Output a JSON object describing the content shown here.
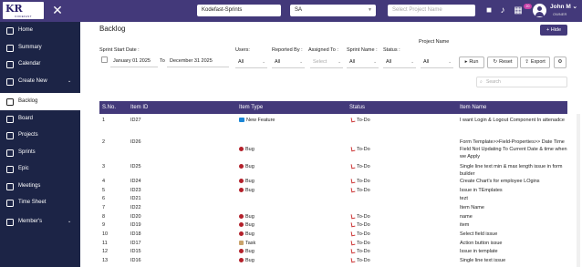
{
  "brand": {
    "logo_text": "KR",
    "logo_sub": "KODEFAST"
  },
  "topbar": {
    "workspace": "Kodefast-Sprints",
    "project_code": "SA",
    "project_placeholder": "Select Project Name",
    "notification_count": "20",
    "user_name": "John M",
    "user_role": "OWNER"
  },
  "sidebar": {
    "items": [
      {
        "label": "Home"
      },
      {
        "label": "Summary"
      },
      {
        "label": "Calendar"
      },
      {
        "label": "Create New"
      },
      {
        "label": "Backlog"
      },
      {
        "label": "Board"
      },
      {
        "label": "Projects"
      },
      {
        "label": "Sprints"
      },
      {
        "label": "Epic"
      },
      {
        "label": "Meetings"
      },
      {
        "label": "Time Sheet"
      },
      {
        "label": "Member's"
      }
    ]
  },
  "page": {
    "title": "Backlog",
    "hide_label": "Hide"
  },
  "filters": {
    "sprint_start_label": "Sprint Start Date :",
    "date_from": "January 01 2025",
    "to_label": "To",
    "date_to": "December 31 2025",
    "users_label": "Users:",
    "users_value": "All",
    "reported_by_label": "Reported By :",
    "reported_by_value": "All",
    "assigned_to_label": "Assigned To :",
    "assigned_to_value": "Select",
    "sprint_name_label": "Sprint Name :",
    "sprint_name_value": "All",
    "status_label": "Status :",
    "status_value": "All",
    "project_name_label": "Project Name",
    "project_name_value": "All",
    "run_label": "Run",
    "reset_label": "Reset",
    "export_label": "Export",
    "search_placeholder": "Search"
  },
  "table": {
    "headers": {
      "sno": "S.No.",
      "item_id": "Item ID",
      "item_type": "Item Type",
      "status": "Status",
      "item_name": "Item Name"
    },
    "rows": [
      {
        "sno": "1",
        "item_id": "ID27",
        "type": "New Feature",
        "type_icon": "new-feature",
        "status": "To-Do",
        "name": "I want Login & Logout Component In attenadce"
      },
      {
        "sno": "2",
        "item_id": "ID26",
        "type": "Bug",
        "type_icon": "bug",
        "status": "To-Do",
        "name": "Form Template>>Field-Properties>> Date Time Field Not Updating To Current Date & time when we Apply"
      },
      {
        "sno": "3",
        "item_id": "ID25",
        "type": "Bug",
        "type_icon": "bug",
        "status": "To-Do",
        "name": "Single line text min & max length issue in form builder"
      },
      {
        "sno": "4",
        "item_id": "ID24",
        "type": "Bug",
        "type_icon": "bug",
        "status": "To-Do",
        "name": "Create Chart's for employee LOgins"
      },
      {
        "sno": "5",
        "item_id": "ID23",
        "type": "Bug",
        "type_icon": "bug",
        "status": "To-Do",
        "name": "Issue in TEmplates"
      },
      {
        "sno": "6",
        "item_id": "ID21",
        "type": "",
        "type_icon": "",
        "status": "",
        "name": "tezt"
      },
      {
        "sno": "7",
        "item_id": "ID22",
        "type": "",
        "type_icon": "",
        "status": "",
        "name": "Item Name"
      },
      {
        "sno": "8",
        "item_id": "ID20",
        "type": "Bug",
        "type_icon": "bug",
        "status": "To-Do",
        "name": "name"
      },
      {
        "sno": "9",
        "item_id": "ID19",
        "type": "Bug",
        "type_icon": "bug",
        "status": "To-Do",
        "name": "item"
      },
      {
        "sno": "10",
        "item_id": "ID18",
        "type": "Bug",
        "type_icon": "bug",
        "status": "To-Do",
        "name": "Select field issue"
      },
      {
        "sno": "11",
        "item_id": "ID17",
        "type": "Task",
        "type_icon": "task",
        "status": "To-Do",
        "name": "Action button issue"
      },
      {
        "sno": "12",
        "item_id": "ID15",
        "type": "Bug",
        "type_icon": "bug",
        "status": "To-Do",
        "name": "Issue in template"
      },
      {
        "sno": "13",
        "item_id": "ID16",
        "type": "Bug",
        "type_icon": "bug",
        "status": "To-Do",
        "name": "Single line text issue"
      }
    ]
  },
  "colors": {
    "primary": "#43397a",
    "sidebar": "#1c2446",
    "badge": "#c840a8",
    "bug": "#b3202a",
    "new_feature": "#1b86d6"
  }
}
